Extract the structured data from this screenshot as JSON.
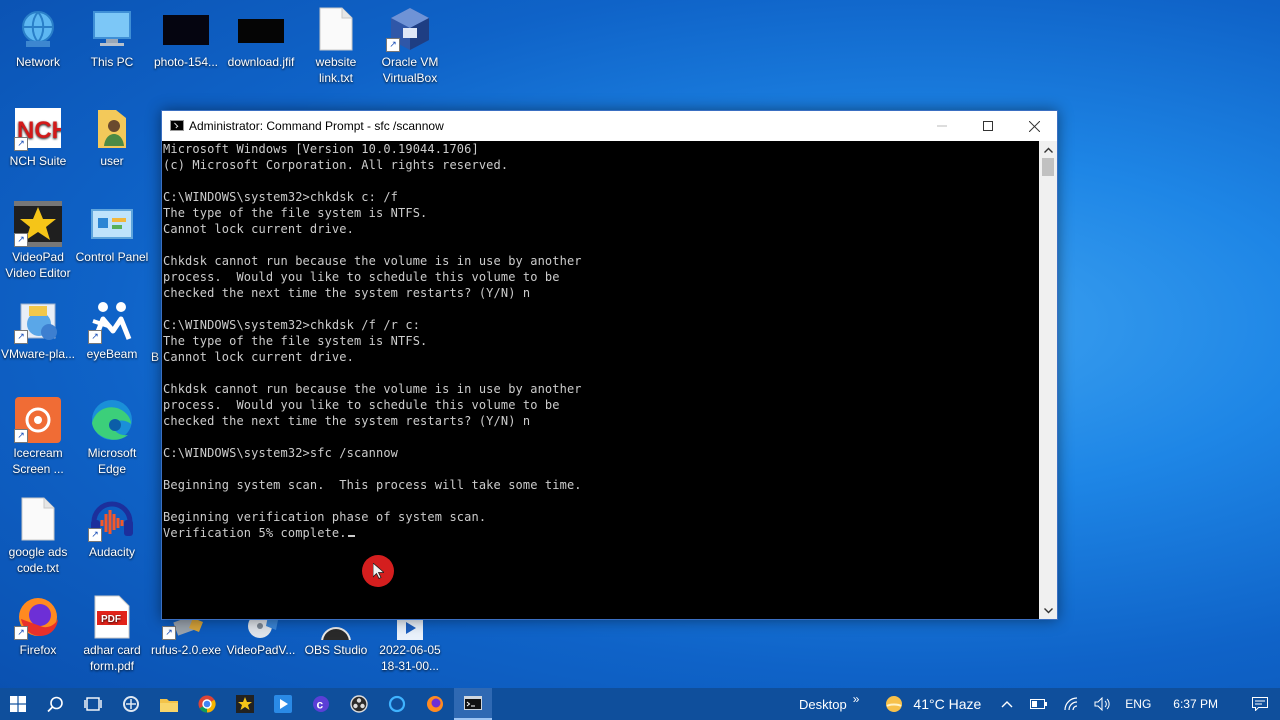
{
  "desktop": {
    "icons": [
      {
        "label": "Network"
      },
      {
        "label": "This PC"
      },
      {
        "label": "photo-154..."
      },
      {
        "label": "download.jfif"
      },
      {
        "label": "website link.txt"
      },
      {
        "label": "Oracle VM VirtualBox"
      },
      {
        "label": "NCH Suite"
      },
      {
        "label": "user"
      },
      {
        "label": "VideoPad Video Editor"
      },
      {
        "label": "Control Panel"
      },
      {
        "label": "VMware-pla..."
      },
      {
        "label": "eyeBeam"
      },
      {
        "label": "Icecream Screen ..."
      },
      {
        "label": "Microsoft Edge"
      },
      {
        "label": "google ads code.txt"
      },
      {
        "label": "Audacity"
      },
      {
        "label": "Firefox"
      },
      {
        "label": "adhar card form.pdf"
      },
      {
        "label": "rufus-2.0.exe"
      },
      {
        "label": "VideoPadV..."
      },
      {
        "label": "OBS Studio"
      },
      {
        "label": "2022-06-05 18-31-00..."
      }
    ],
    "partial_label": "B"
  },
  "window": {
    "title": "Administrator: Command Prompt - sfc  /scannow",
    "console_lines": [
      "Microsoft Windows [Version 10.0.19044.1706]",
      "(c) Microsoft Corporation. All rights reserved.",
      "",
      "C:\\WINDOWS\\system32>chkdsk c: /f",
      "The type of the file system is NTFS.",
      "Cannot lock current drive.",
      "",
      "Chkdsk cannot run because the volume is in use by another",
      "process.  Would you like to schedule this volume to be",
      "checked the next time the system restarts? (Y/N) n",
      "",
      "C:\\WINDOWS\\system32>chkdsk /f /r c:",
      "The type of the file system is NTFS.",
      "Cannot lock current drive.",
      "",
      "Chkdsk cannot run because the volume is in use by another",
      "process.  Would you like to schedule this volume to be",
      "checked the next time the system restarts? (Y/N) n",
      "",
      "C:\\WINDOWS\\system32>sfc /scannow",
      "",
      "Beginning system scan.  This process will take some time.",
      "",
      "Beginning verification phase of system scan.",
      "Verification 5% complete."
    ]
  },
  "taskbar": {
    "desktop_label": "Desktop",
    "more_glyph": "»",
    "weather": "41°C  Haze",
    "language": "ENG",
    "time": "6:37 PM"
  },
  "colors": {
    "taskbar": "#0f4f9c",
    "console_bg": "#000000",
    "console_text": "#cccccc",
    "accent": "#0a64d8"
  }
}
